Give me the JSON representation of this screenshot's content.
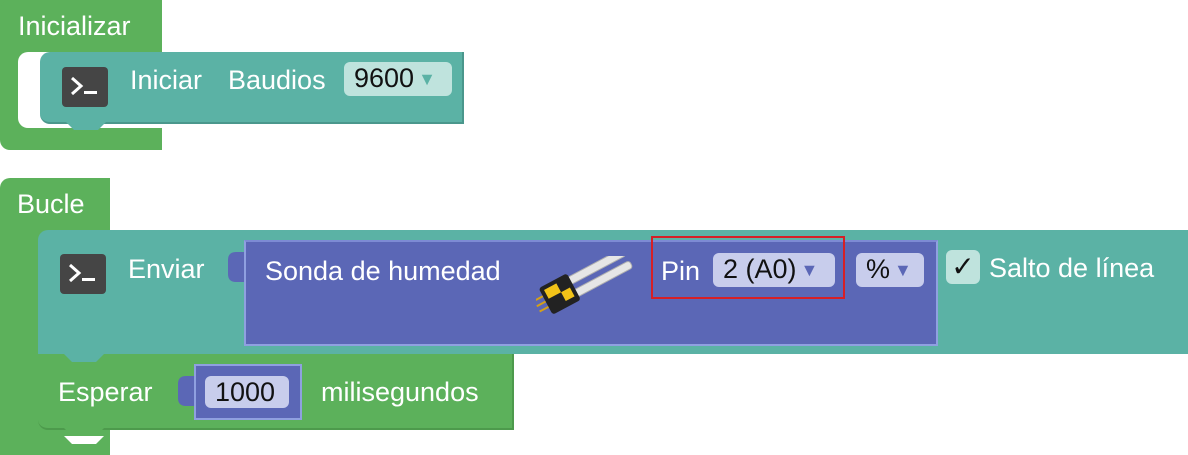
{
  "setup_block": {
    "title": "Inicializar",
    "serial_begin": {
      "label_start": "Iniciar",
      "label_baud": "Baudios",
      "baud_value": "9600"
    }
  },
  "loop_block": {
    "title": "Bucle",
    "serial_send": {
      "label": "Enviar",
      "newline_checkbox": {
        "checked": true,
        "check_glyph": "✓",
        "label": "Salto de línea"
      },
      "sensor": {
        "name": "Sonda de humedad",
        "image": "soil-moisture-sensor-image",
        "pin_label": "Pin",
        "pin_value": "2 (A0)",
        "unit_value": "%"
      }
    },
    "delay": {
      "label": "Esperar",
      "value": "1000",
      "unit": "milisegundos"
    }
  },
  "dropdown_caret": "▼",
  "highlight_color": "#d61f26",
  "colors": {
    "control_green": "#5cb15b",
    "serial_teal": "#5bb2a5",
    "sensor_blue": "#5b67b6"
  }
}
